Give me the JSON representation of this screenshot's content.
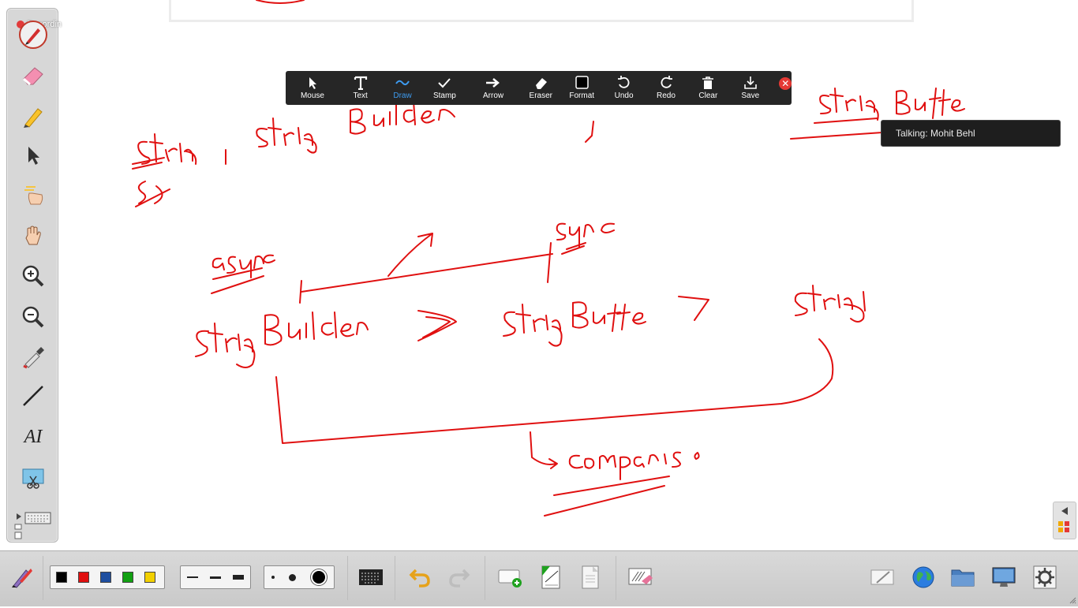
{
  "recording": {
    "label": "Recordin"
  },
  "annotate_toolbar": {
    "tools": [
      {
        "id": "mouse",
        "label": "Mouse",
        "icon": "cursor-icon"
      },
      {
        "id": "text",
        "label": "Text",
        "icon": "text-icon"
      },
      {
        "id": "draw",
        "label": "Draw",
        "icon": "draw-squiggle-icon",
        "active": true
      },
      {
        "id": "stamp",
        "label": "Stamp",
        "icon": "checkmark-icon"
      },
      {
        "id": "arrow",
        "label": "Arrow",
        "icon": "arrow-right-icon"
      },
      {
        "id": "eraser",
        "label": "Eraser",
        "icon": "eraser-icon"
      },
      {
        "id": "format",
        "label": "Format",
        "icon": "format-square-icon"
      },
      {
        "id": "undo",
        "label": "Undo",
        "icon": "undo-icon"
      },
      {
        "id": "redo",
        "label": "Redo",
        "icon": "redo-icon"
      },
      {
        "id": "clear",
        "label": "Clear",
        "icon": "trash-icon"
      },
      {
        "id": "save",
        "label": "Save",
        "icon": "download-icon"
      }
    ],
    "active_color": "#3d9bf0"
  },
  "talking_indicator": {
    "text": "Talking: Mohit Behl"
  },
  "left_toolbox": {
    "tools": [
      "pen-icon",
      "eraser-icon",
      "highlighter-icon",
      "select-arrow-icon",
      "spotlight-hand-icon",
      "pan-hand-icon",
      "zoom-in-icon",
      "zoom-out-icon",
      "eyedropper-icon",
      "line-icon",
      "text-tool-icon",
      "screen-capture-icon"
    ]
  },
  "text_tool_glyph": "AI",
  "bottom_toolbar": {
    "colors": [
      "#000000",
      "#e01010",
      "#1f4fa0",
      "#12a012",
      "#f2d000"
    ],
    "ink_color": "#e01010"
  }
}
